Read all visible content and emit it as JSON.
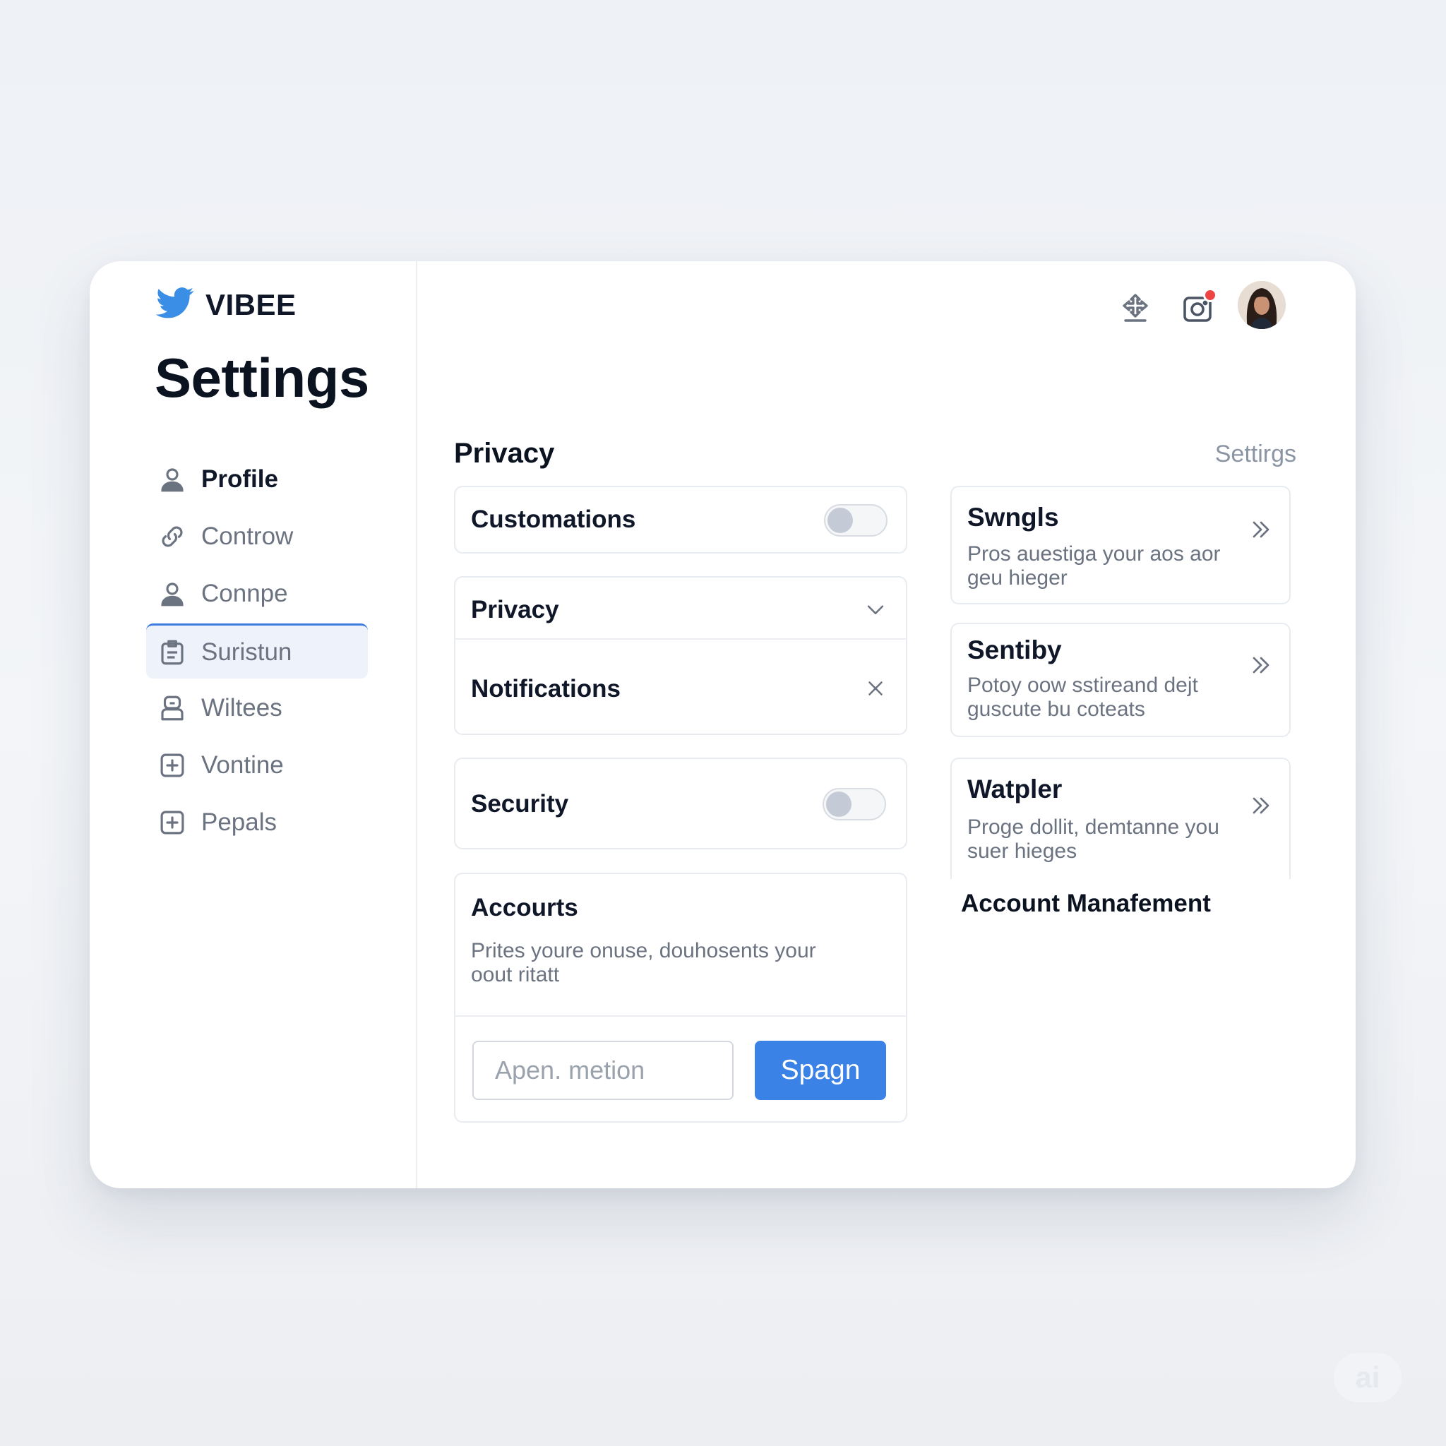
{
  "brand": {
    "name": "VIBEE",
    "logo_icon": "bird-logo-icon",
    "accent": "#3b8ee6"
  },
  "sidebar": {
    "title": "Settings",
    "items": [
      {
        "label": "Profile",
        "icon": "user-icon"
      },
      {
        "label": "Controw",
        "icon": "link-edit-icon"
      },
      {
        "label": "Connpe",
        "icon": "user-icon"
      },
      {
        "label": "Suristun",
        "icon": "clipboard-icon",
        "active": true
      },
      {
        "label": "Wiltees",
        "icon": "robot-icon"
      },
      {
        "label": "Vontine",
        "icon": "plus-square-icon"
      },
      {
        "label": "Pepals",
        "icon": "plus-square-icon"
      }
    ]
  },
  "topbar": {
    "icons": [
      "upload-icon",
      "camera-icon"
    ],
    "notification_color": "#ef4444",
    "avatar": "user-avatar"
  },
  "main": {
    "section_title": "Privacy",
    "breadcrumb": "Settirgs",
    "customizations": {
      "label": "Customations",
      "toggle_on": false
    },
    "privacy_group": {
      "privacy_label": "Privacy",
      "notifications_label": "Notifications"
    },
    "security": {
      "label": "Security",
      "toggle_on": false
    },
    "accounts": {
      "title": "Accourts",
      "description_line1": "Prites youre onuse, douhosents your",
      "description_line2": "oout ritatt",
      "input_placeholder": "Apen. metion",
      "button_label": "Spagn",
      "button_color": "#3b82e6"
    }
  },
  "right_cards": [
    {
      "title": "Swngls",
      "line1": "Pros auestiga your aos aor",
      "line2": "geu hieger"
    },
    {
      "title": "Sentiby",
      "line1": "Potoy oow sstireand dejt",
      "line2": "guscute bu coteats"
    },
    {
      "title": "Watpler",
      "line1": "Proge dollit, demtanne you",
      "line2": "suer hieges"
    }
  ],
  "account_management": {
    "title": "Account Manafement"
  },
  "watermark": "ai"
}
